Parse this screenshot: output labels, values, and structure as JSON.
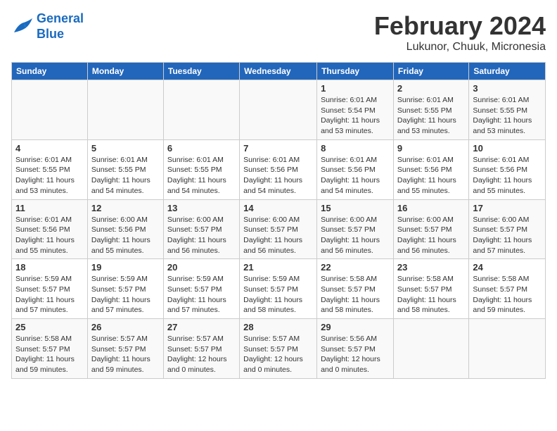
{
  "logo": {
    "line1": "General",
    "line2": "Blue"
  },
  "title": "February 2024",
  "subtitle": "Lukunor, Chuuk, Micronesia",
  "headers": [
    "Sunday",
    "Monday",
    "Tuesday",
    "Wednesday",
    "Thursday",
    "Friday",
    "Saturday"
  ],
  "weeks": [
    [
      {
        "day": "",
        "info": ""
      },
      {
        "day": "",
        "info": ""
      },
      {
        "day": "",
        "info": ""
      },
      {
        "day": "",
        "info": ""
      },
      {
        "day": "1",
        "info": "Sunrise: 6:01 AM\nSunset: 5:54 PM\nDaylight: 11 hours and 53 minutes."
      },
      {
        "day": "2",
        "info": "Sunrise: 6:01 AM\nSunset: 5:55 PM\nDaylight: 11 hours and 53 minutes."
      },
      {
        "day": "3",
        "info": "Sunrise: 6:01 AM\nSunset: 5:55 PM\nDaylight: 11 hours and 53 minutes."
      }
    ],
    [
      {
        "day": "4",
        "info": "Sunrise: 6:01 AM\nSunset: 5:55 PM\nDaylight: 11 hours and 53 minutes."
      },
      {
        "day": "5",
        "info": "Sunrise: 6:01 AM\nSunset: 5:55 PM\nDaylight: 11 hours and 54 minutes."
      },
      {
        "day": "6",
        "info": "Sunrise: 6:01 AM\nSunset: 5:55 PM\nDaylight: 11 hours and 54 minutes."
      },
      {
        "day": "7",
        "info": "Sunrise: 6:01 AM\nSunset: 5:56 PM\nDaylight: 11 hours and 54 minutes."
      },
      {
        "day": "8",
        "info": "Sunrise: 6:01 AM\nSunset: 5:56 PM\nDaylight: 11 hours and 54 minutes."
      },
      {
        "day": "9",
        "info": "Sunrise: 6:01 AM\nSunset: 5:56 PM\nDaylight: 11 hours and 55 minutes."
      },
      {
        "day": "10",
        "info": "Sunrise: 6:01 AM\nSunset: 5:56 PM\nDaylight: 11 hours and 55 minutes."
      }
    ],
    [
      {
        "day": "11",
        "info": "Sunrise: 6:01 AM\nSunset: 5:56 PM\nDaylight: 11 hours and 55 minutes."
      },
      {
        "day": "12",
        "info": "Sunrise: 6:00 AM\nSunset: 5:56 PM\nDaylight: 11 hours and 55 minutes."
      },
      {
        "day": "13",
        "info": "Sunrise: 6:00 AM\nSunset: 5:57 PM\nDaylight: 11 hours and 56 minutes."
      },
      {
        "day": "14",
        "info": "Sunrise: 6:00 AM\nSunset: 5:57 PM\nDaylight: 11 hours and 56 minutes."
      },
      {
        "day": "15",
        "info": "Sunrise: 6:00 AM\nSunset: 5:57 PM\nDaylight: 11 hours and 56 minutes."
      },
      {
        "day": "16",
        "info": "Sunrise: 6:00 AM\nSunset: 5:57 PM\nDaylight: 11 hours and 56 minutes."
      },
      {
        "day": "17",
        "info": "Sunrise: 6:00 AM\nSunset: 5:57 PM\nDaylight: 11 hours and 57 minutes."
      }
    ],
    [
      {
        "day": "18",
        "info": "Sunrise: 5:59 AM\nSunset: 5:57 PM\nDaylight: 11 hours and 57 minutes."
      },
      {
        "day": "19",
        "info": "Sunrise: 5:59 AM\nSunset: 5:57 PM\nDaylight: 11 hours and 57 minutes."
      },
      {
        "day": "20",
        "info": "Sunrise: 5:59 AM\nSunset: 5:57 PM\nDaylight: 11 hours and 57 minutes."
      },
      {
        "day": "21",
        "info": "Sunrise: 5:59 AM\nSunset: 5:57 PM\nDaylight: 11 hours and 58 minutes."
      },
      {
        "day": "22",
        "info": "Sunrise: 5:58 AM\nSunset: 5:57 PM\nDaylight: 11 hours and 58 minutes."
      },
      {
        "day": "23",
        "info": "Sunrise: 5:58 AM\nSunset: 5:57 PM\nDaylight: 11 hours and 58 minutes."
      },
      {
        "day": "24",
        "info": "Sunrise: 5:58 AM\nSunset: 5:57 PM\nDaylight: 11 hours and 59 minutes."
      }
    ],
    [
      {
        "day": "25",
        "info": "Sunrise: 5:58 AM\nSunset: 5:57 PM\nDaylight: 11 hours and 59 minutes."
      },
      {
        "day": "26",
        "info": "Sunrise: 5:57 AM\nSunset: 5:57 PM\nDaylight: 11 hours and 59 minutes."
      },
      {
        "day": "27",
        "info": "Sunrise: 5:57 AM\nSunset: 5:57 PM\nDaylight: 12 hours and 0 minutes."
      },
      {
        "day": "28",
        "info": "Sunrise: 5:57 AM\nSunset: 5:57 PM\nDaylight: 12 hours and 0 minutes."
      },
      {
        "day": "29",
        "info": "Sunrise: 5:56 AM\nSunset: 5:57 PM\nDaylight: 12 hours and 0 minutes."
      },
      {
        "day": "",
        "info": ""
      },
      {
        "day": "",
        "info": ""
      }
    ]
  ]
}
